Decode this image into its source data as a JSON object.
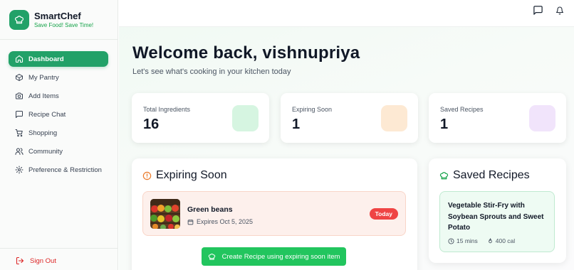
{
  "brand": {
    "name": "SmartChef",
    "tagline": "Save Food! Save Time!"
  },
  "sidebar": {
    "items": [
      {
        "label": "Dashboard",
        "icon": "home-icon",
        "active": true
      },
      {
        "label": "My Pantry",
        "icon": "box-icon"
      },
      {
        "label": "Add Items",
        "icon": "camera-icon"
      },
      {
        "label": "Recipe Chat",
        "icon": "chat-icon"
      },
      {
        "label": "Shopping",
        "icon": "cart-icon"
      },
      {
        "label": "Community",
        "icon": "users-icon"
      },
      {
        "label": "Preference & Restriction",
        "icon": "gear-icon"
      }
    ],
    "sign_out": "Sign Out"
  },
  "header": {
    "welcome": "Welcome back, vishnupriya",
    "subtitle": "Let's see what's cooking in your kitchen today"
  },
  "stats": [
    {
      "label": "Total Ingredients",
      "value": "16",
      "color": "#d6f5e1"
    },
    {
      "label": "Expiring Soon",
      "value": "1",
      "color": "#fde9d3"
    },
    {
      "label": "Saved Recipes",
      "value": "1",
      "color": "#f1e4fb"
    }
  ],
  "expiring": {
    "title": "Expiring Soon",
    "item": {
      "name": "Green beans",
      "expires": "Expires Oct 5, 2025",
      "badge": "Today"
    },
    "cta": "Create Recipe using expiring soon item"
  },
  "saved_recipes": {
    "title": "Saved Recipes",
    "recipe": {
      "name": "Vegetable Stir-Fry with Soybean Sprouts and Sweet Potato",
      "time": "15 mins",
      "calories": "400 cal"
    }
  },
  "colors": {
    "accent": "#22a168",
    "danger": "#ef4444",
    "cta": "#22c55e"
  }
}
